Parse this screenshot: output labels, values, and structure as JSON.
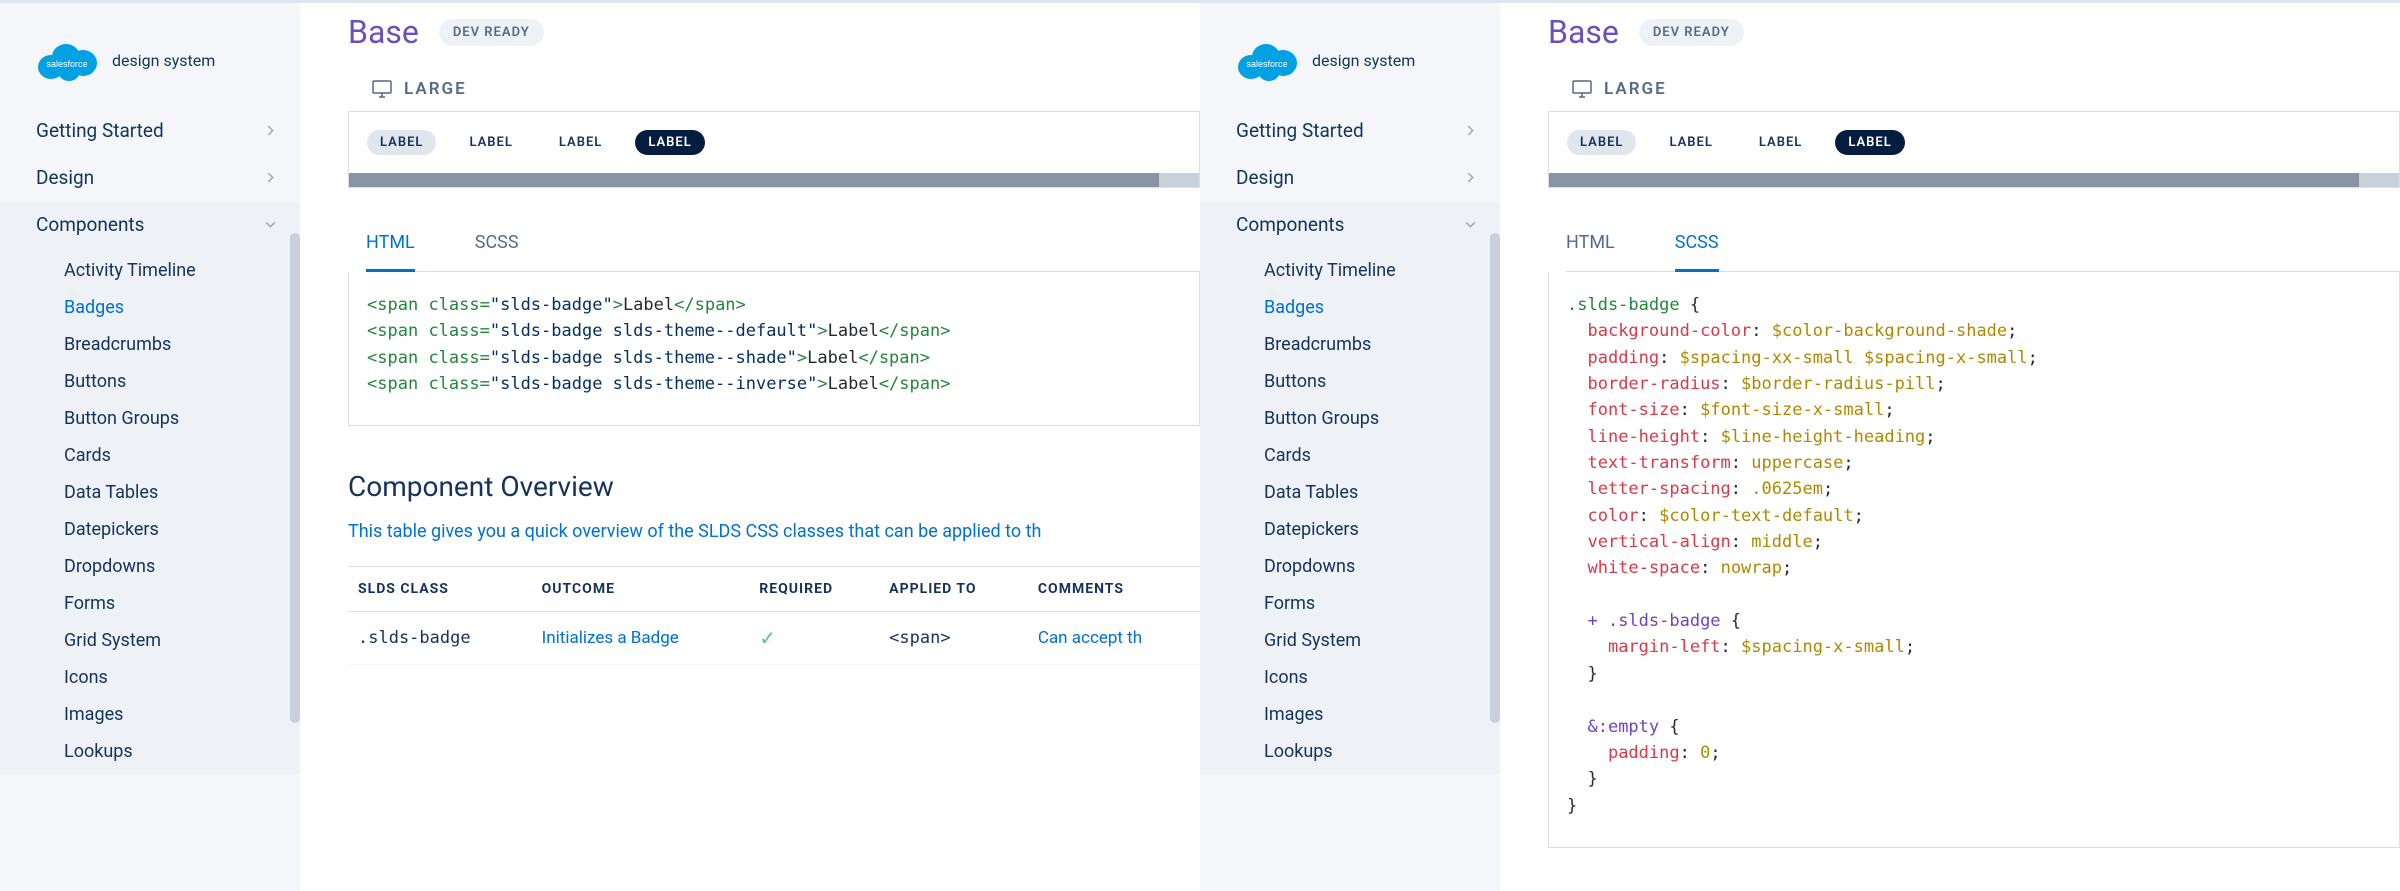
{
  "brand": "design system",
  "nav": {
    "top": [
      "Getting Started",
      "Design",
      "Components"
    ],
    "components": [
      "Activity Timeline",
      "Badges",
      "Breadcrumbs",
      "Buttons",
      "Button Groups",
      "Cards",
      "Data Tables",
      "Datepickers",
      "Dropdowns",
      "Forms",
      "Grid System",
      "Icons",
      "Images",
      "Lookups"
    ],
    "active": "Badges"
  },
  "page": {
    "title": "Base",
    "status": "DEV READY",
    "sizeLabel": "LARGE"
  },
  "badges": [
    "LABEL",
    "LABEL",
    "LABEL",
    "LABEL"
  ],
  "tabs": {
    "html": "HTML",
    "scss": "SCSS"
  },
  "htmlCode": {
    "lines": [
      {
        "cls": "slds-badge",
        "txt": "Label"
      },
      {
        "cls": "slds-badge slds-theme--default",
        "txt": "Label"
      },
      {
        "cls": "slds-badge slds-theme--shade",
        "txt": "Label"
      },
      {
        "cls": "slds-badge slds-theme--inverse",
        "txt": "Label"
      }
    ]
  },
  "scssCode": {
    "selector": ".slds-badge",
    "props": [
      [
        "background-color",
        "$color-background-shade"
      ],
      [
        "padding",
        "$spacing-xx-small $spacing-x-small"
      ],
      [
        "border-radius",
        "$border-radius-pill"
      ],
      [
        "font-size",
        "$font-size-x-small"
      ],
      [
        "line-height",
        "$line-height-heading"
      ],
      [
        "text-transform",
        "uppercase"
      ],
      [
        "letter-spacing",
        ".0625em"
      ],
      [
        "color",
        "$color-text-default"
      ],
      [
        "vertical-align",
        "middle"
      ],
      [
        "white-space",
        "nowrap"
      ]
    ],
    "nested": {
      "sel": "+ .slds-badge",
      "props": [
        [
          "margin-left",
          "$spacing-x-small"
        ]
      ]
    },
    "empty": {
      "sel": "&:empty",
      "props": [
        [
          "padding",
          "0"
        ]
      ]
    }
  },
  "overview": {
    "title": "Component Overview",
    "desc": "This table gives you a quick overview of the SLDS CSS classes that can be applied to th",
    "headers": [
      "SLDS CLASS",
      "OUTCOME",
      "REQUIRED",
      "APPLIED TO",
      "COMMENTS"
    ],
    "row": {
      "cls": ".slds-badge",
      "outcome": "Initializes a Badge",
      "applied": "<span>",
      "comment": "Can accept th"
    }
  }
}
